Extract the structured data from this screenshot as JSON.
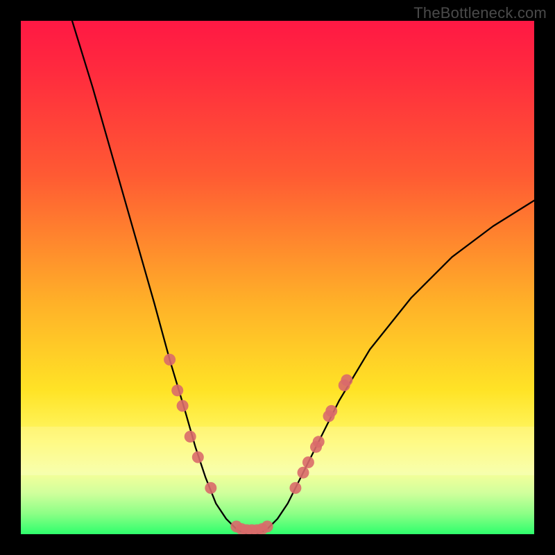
{
  "watermark": "TheBottleneck.com",
  "chart_data": {
    "type": "line",
    "title": "",
    "xlabel": "",
    "ylabel": "",
    "xlim": [
      0,
      100
    ],
    "ylim": [
      0,
      100
    ],
    "grid": false,
    "legend": false,
    "series": [
      {
        "name": "curve",
        "x": [
          10,
          14,
          18,
          22,
          26,
          29,
          32,
          34,
          36,
          38,
          40,
          42,
          44,
          46,
          48,
          50,
          52,
          54,
          58,
          62,
          68,
          76,
          84,
          92,
          100
        ],
        "y": [
          100,
          87,
          73,
          59,
          45,
          34,
          24,
          17,
          11,
          6,
          3,
          1,
          0,
          0,
          1,
          3,
          6,
          10,
          18,
          26,
          36,
          46,
          54,
          60,
          65
        ]
      }
    ],
    "markers": [
      {
        "x": 29,
        "y": 34
      },
      {
        "x": 30.5,
        "y": 28
      },
      {
        "x": 31.5,
        "y": 25
      },
      {
        "x": 33,
        "y": 19
      },
      {
        "x": 34.5,
        "y": 15
      },
      {
        "x": 37,
        "y": 9
      },
      {
        "x": 42,
        "y": 1.5
      },
      {
        "x": 43,
        "y": 1
      },
      {
        "x": 44,
        "y": 0.8
      },
      {
        "x": 45,
        "y": 0.8
      },
      {
        "x": 46,
        "y": 0.8
      },
      {
        "x": 47,
        "y": 1
      },
      {
        "x": 48,
        "y": 1.5
      },
      {
        "x": 53.5,
        "y": 9
      },
      {
        "x": 55,
        "y": 12
      },
      {
        "x": 56,
        "y": 14
      },
      {
        "x": 57.5,
        "y": 17
      },
      {
        "x": 58,
        "y": 18
      },
      {
        "x": 60,
        "y": 23
      },
      {
        "x": 60.5,
        "y": 24
      },
      {
        "x": 63,
        "y": 29
      },
      {
        "x": 63.5,
        "y": 30
      }
    ],
    "gradient_stops": [
      {
        "pos": 0.0,
        "color": "#ff1844"
      },
      {
        "pos": 0.1,
        "color": "#ff2b3e"
      },
      {
        "pos": 0.3,
        "color": "#ff5a33"
      },
      {
        "pos": 0.55,
        "color": "#ffb128"
      },
      {
        "pos": 0.72,
        "color": "#ffe326"
      },
      {
        "pos": 0.82,
        "color": "#fff96a"
      },
      {
        "pos": 0.88,
        "color": "#f6ff9a"
      },
      {
        "pos": 0.92,
        "color": "#d0ff9c"
      },
      {
        "pos": 0.96,
        "color": "#8cff86"
      },
      {
        "pos": 1.0,
        "color": "#2eff6c"
      }
    ]
  }
}
